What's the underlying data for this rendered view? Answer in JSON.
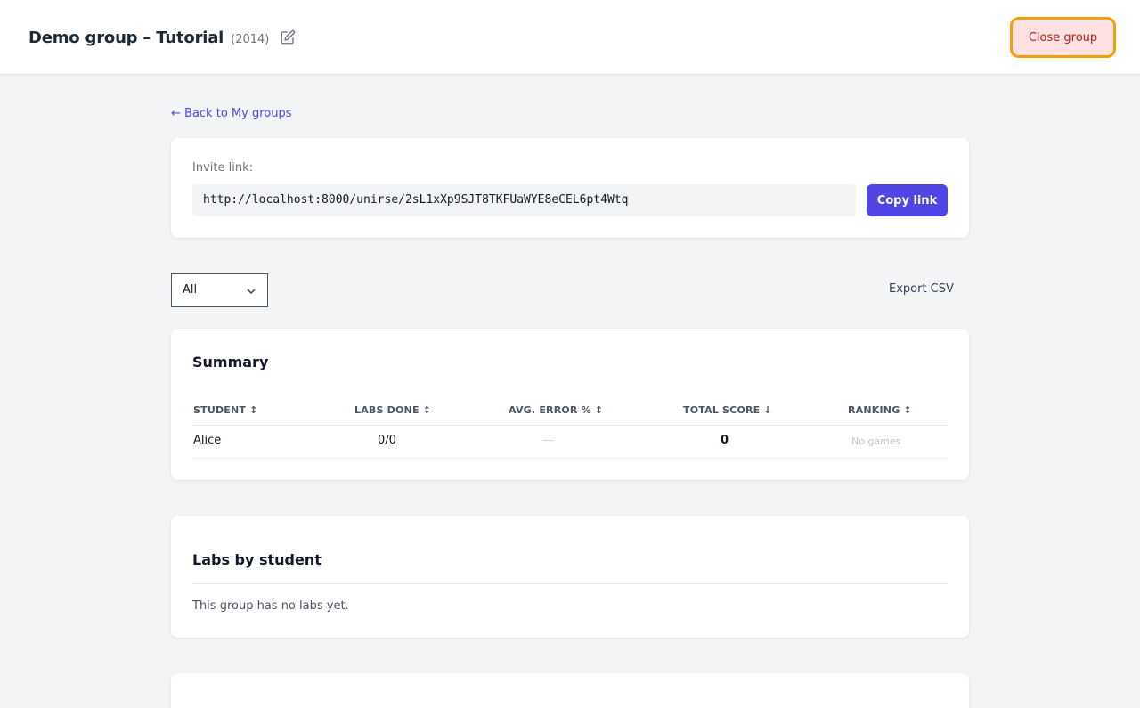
{
  "header": {
    "title": "Demo group – Tutorial",
    "year": "(2014)",
    "close_label": "Close group",
    "icons": {
      "edit": "pencil-square-icon"
    }
  },
  "nav": {
    "back_label": "← Back to My groups"
  },
  "invite": {
    "label": "Invite link:",
    "url": "http://localhost:8000/unirse/2sL1xXp9SJT8TKFUaWYE8eCEL6pt4Wtq",
    "copy_label": "Copy link"
  },
  "filter": {
    "selected": "All",
    "icon": "chevron-down-icon"
  },
  "export_label": "Export CSV",
  "summary": {
    "title": "Summary",
    "columns": [
      "STUDENT ↕",
      "LABS DONE ↕",
      "AVG. ERROR % ↕",
      "TOTAL SCORE ↓",
      "RANKING ↕"
    ],
    "rows": [
      {
        "student": "Alice",
        "labs_done": "0/0",
        "avg_error": "—",
        "total_score": "0",
        "ranking": "No games"
      }
    ]
  },
  "labs": {
    "title": "Labs by student",
    "empty_text": "This group has no labs yet."
  },
  "colors": {
    "accent": "#4f46e5",
    "danger_bg": "#fee2e2",
    "danger_text": "#b91c1c",
    "focus_ring": "#f59e0b",
    "page_bg": "#f3f4f6"
  }
}
